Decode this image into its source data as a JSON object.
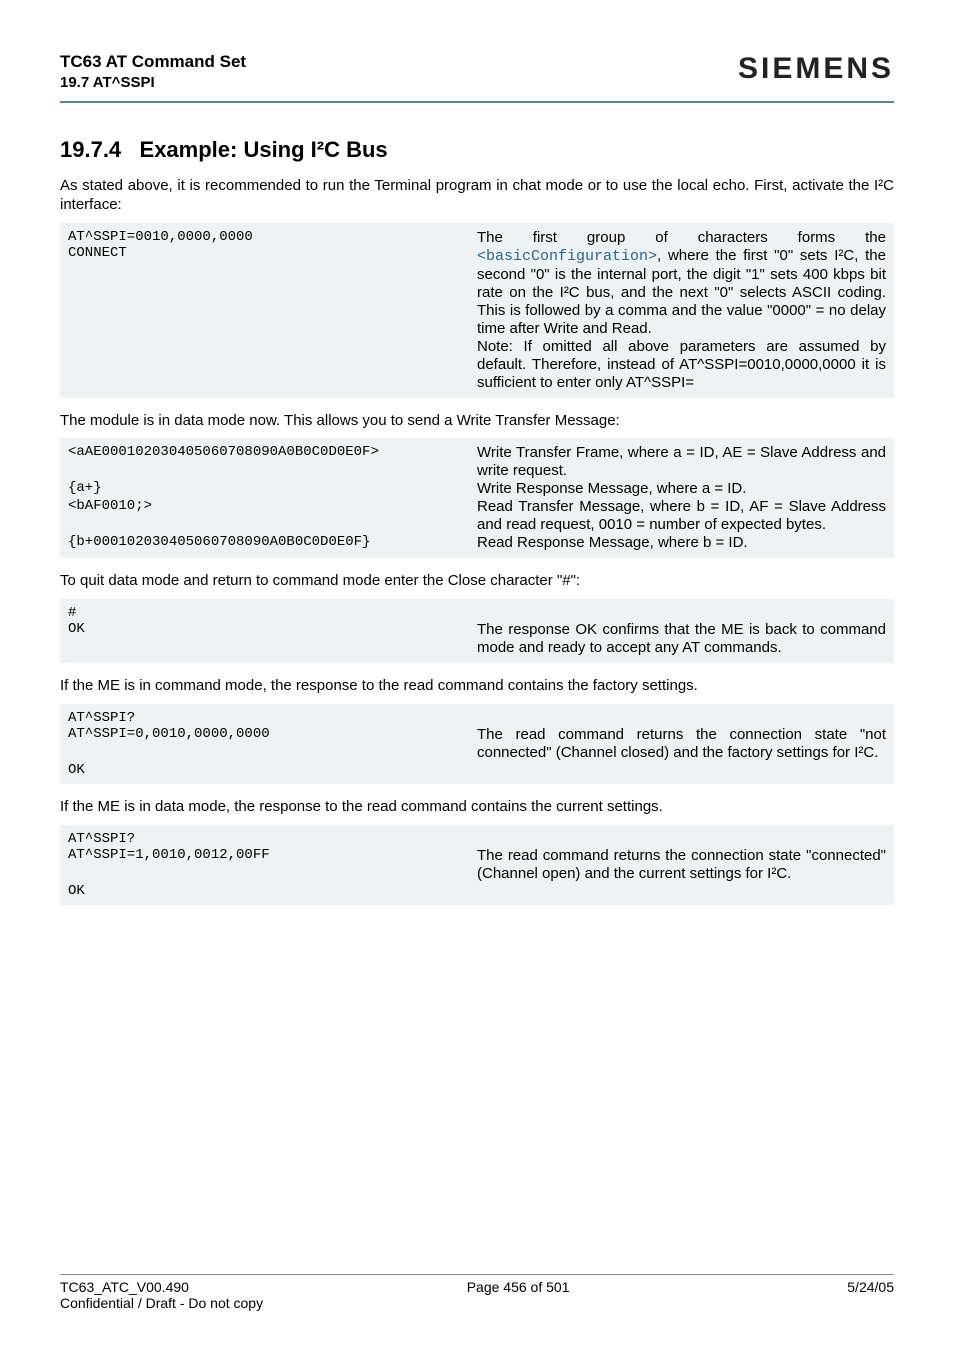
{
  "header": {
    "docTitle": "TC63 AT Command Set",
    "docSub": "19.7 AT^SSPI",
    "brand": "SIEMENS"
  },
  "section": {
    "number": "19.7.4",
    "title": "Example: Using I²C Bus"
  },
  "intro": "As stated above, it is recommended to run the Terminal program in chat mode or to use the local echo. First, activate the I²C interface:",
  "block1": {
    "cmd": "AT^SSPI=0010,0000,0000\nCONNECT",
    "desc_pre": "The first group of characters forms the ",
    "link": "<basicConfiguration>",
    "desc_post": ", where the first \"0\" sets I²C, the second \"0\" is the internal port, the digit \"1\" sets 400 kbps bit rate on the I²C bus, and the next \"0\" selects ASCII coding. This is followed by a comma and the value \"0000\" = no delay time after Write and Read.\nNote: If omitted all above parameters are assumed by default. Therefore, instead of AT^SSPI=0010,0000,0000 it is sufficient to enter only AT^SSPI="
  },
  "para2": "The module is in data mode now. This allows you to send a Write Transfer Message:",
  "block2": {
    "rows": [
      {
        "cmd": "<aAE000102030405060708090A0B0C0D0E0F>",
        "desc": "Write Transfer Frame, where a = ID, AE = Slave Address and write request."
      },
      {
        "cmd": "{a+}",
        "desc": "Write Response Message, where a = ID."
      },
      {
        "cmd": "<bAF0010;>",
        "desc": "Read Transfer Message, where b = ID, AF = Slave Address and read request, 0010 = number of expected bytes."
      },
      {
        "cmd": "{b+000102030405060708090A0B0C0D0E0F}",
        "desc": "Read Response Message, where b = ID."
      }
    ]
  },
  "para3": "To quit data mode and return to command mode enter the Close character \"#\":",
  "block3": {
    "rows": [
      {
        "cmd": "#",
        "desc": ""
      },
      {
        "cmd": "OK",
        "desc": "The response OK confirms that the ME is back to command mode and ready to accept any AT commands."
      }
    ]
  },
  "para4": "If the ME is in command mode, the response to the read command contains the factory settings.",
  "block4": {
    "rows": [
      {
        "cmd": "AT^SSPI?",
        "desc": ""
      },
      {
        "cmd": "AT^SSPI=0,0010,0000,0000",
        "desc": "The read command returns the connection state \"not connected\" (Channel closed) and the factory settings for I²C."
      },
      {
        "cmd": "OK",
        "desc": ""
      }
    ]
  },
  "para5": "If the ME is in data mode, the response to the read command contains the current settings.",
  "block5": {
    "rows": [
      {
        "cmd": "AT^SSPI?",
        "desc": ""
      },
      {
        "cmd": "AT^SSPI=1,0010,0012,00FF",
        "desc": "The read command returns the connection state \"connected\" (Channel open) and the current settings for I²C."
      },
      {
        "cmd": "OK",
        "desc": ""
      }
    ]
  },
  "footer": {
    "left1": "TC63_ATC_V00.490",
    "center1": "Page 456 of 501",
    "right1": "5/24/05",
    "left2": "Confidential / Draft - Do not copy"
  }
}
